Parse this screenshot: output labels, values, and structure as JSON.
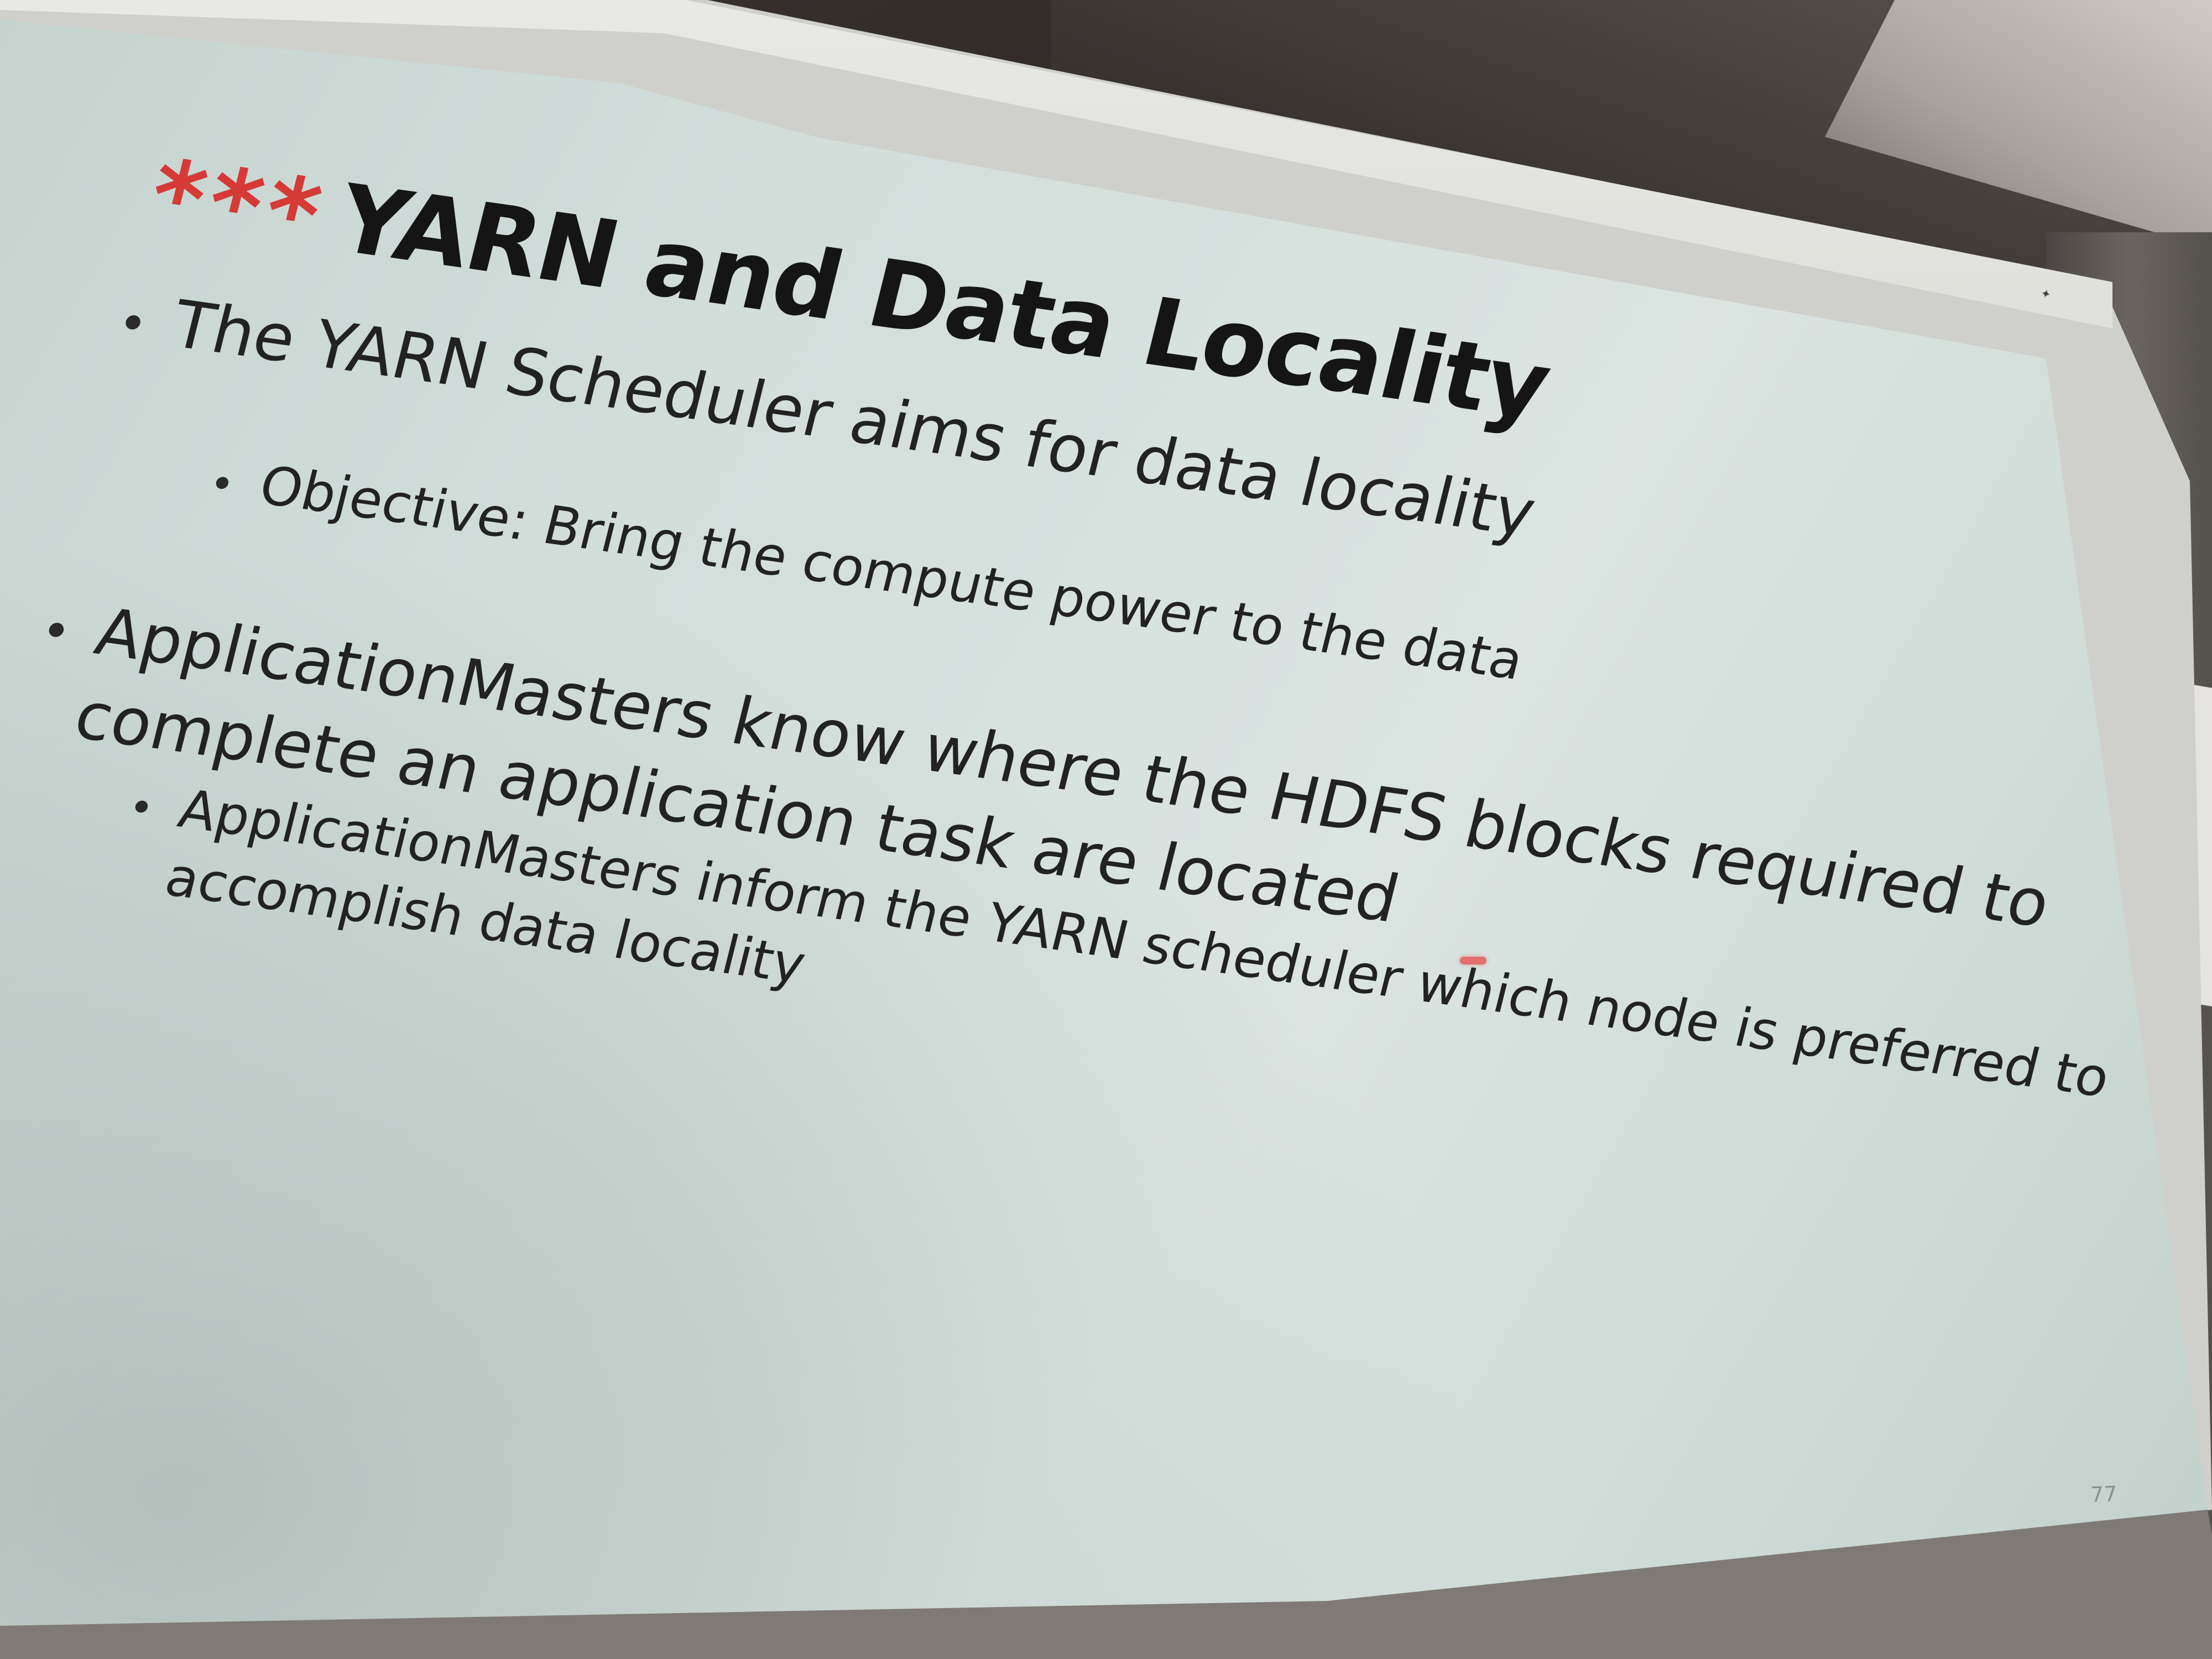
{
  "slide": {
    "title_stars": "***",
    "title": "YARN and Data Locality",
    "bullets": [
      {
        "text": "The YARN Scheduler aims for data locality",
        "sub": [
          {
            "text": "Objective: Bring the compute power to the data"
          }
        ]
      },
      {
        "text_line1": "ApplicationMasters know where the HDFS blocks required to",
        "text_line2": "complete an application task are located",
        "sub": [
          {
            "text_line1": "ApplicationMasters inform the YARN scheduler which node is preferred to",
            "text_line2": "accomplish data locality"
          }
        ]
      }
    ],
    "page_number": "77"
  },
  "colors": {
    "stars": "#d53a36",
    "title": "#151515",
    "body_text": "#222222",
    "slide_background": "#d3dedb"
  }
}
